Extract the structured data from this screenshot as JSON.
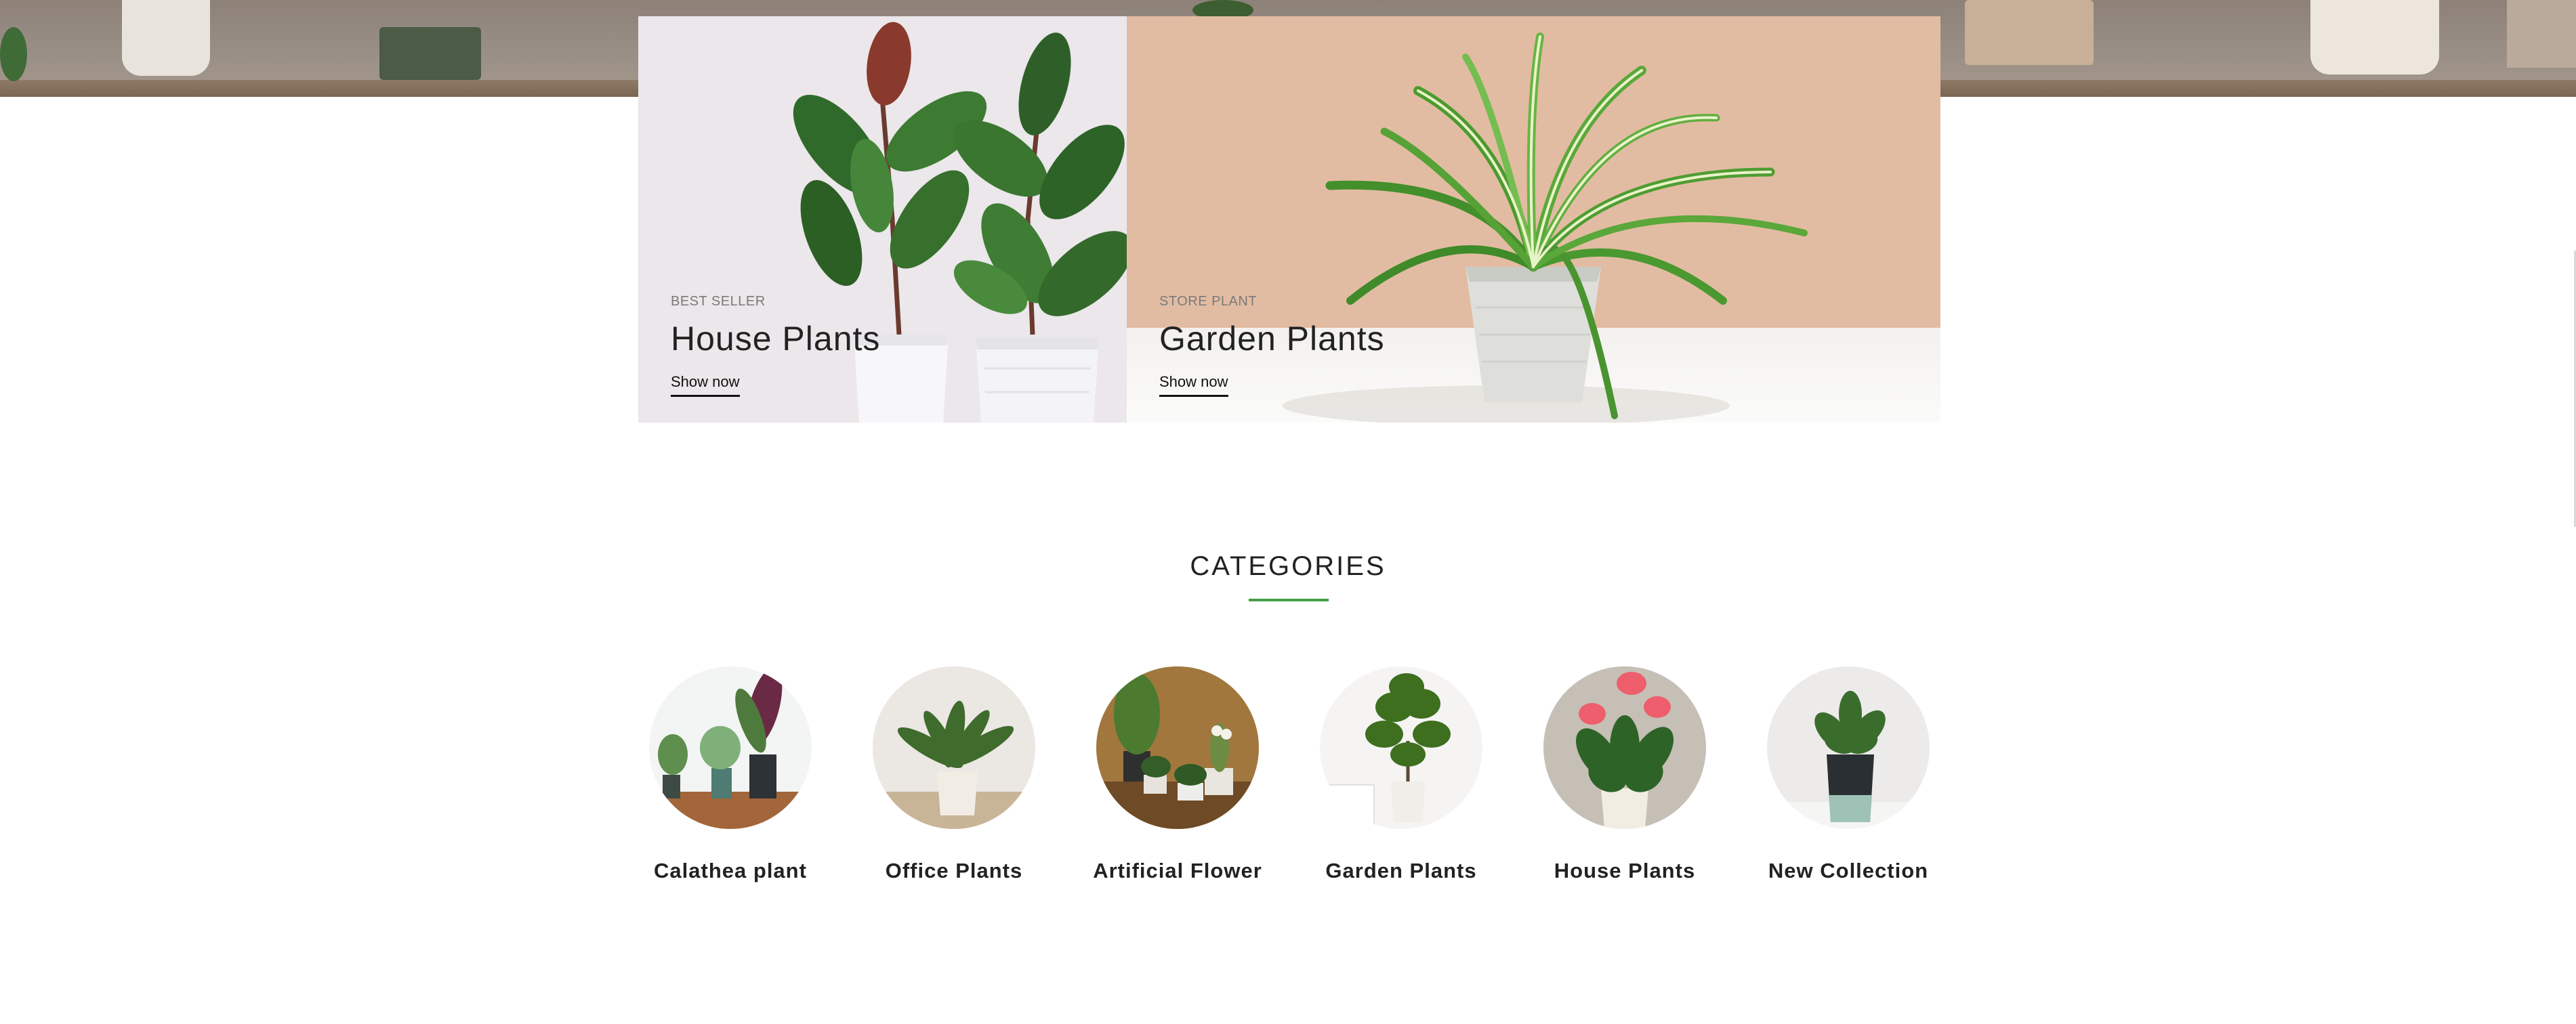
{
  "banners": [
    {
      "subtitle": "BEST SELLER",
      "title": "House Plants",
      "link": "Show now"
    },
    {
      "subtitle": "STORE PLANT",
      "title": "Garden Plants",
      "link": "Show now"
    }
  ],
  "categories_section": {
    "title": "CATEGORIES",
    "accent_color": "#43a047",
    "items": [
      {
        "label": "Calathea plant"
      },
      {
        "label": "Office Plants"
      },
      {
        "label": "Artificial Flower"
      },
      {
        "label": "Garden Plants"
      },
      {
        "label": "House Plants"
      },
      {
        "label": "New Collection"
      }
    ]
  }
}
